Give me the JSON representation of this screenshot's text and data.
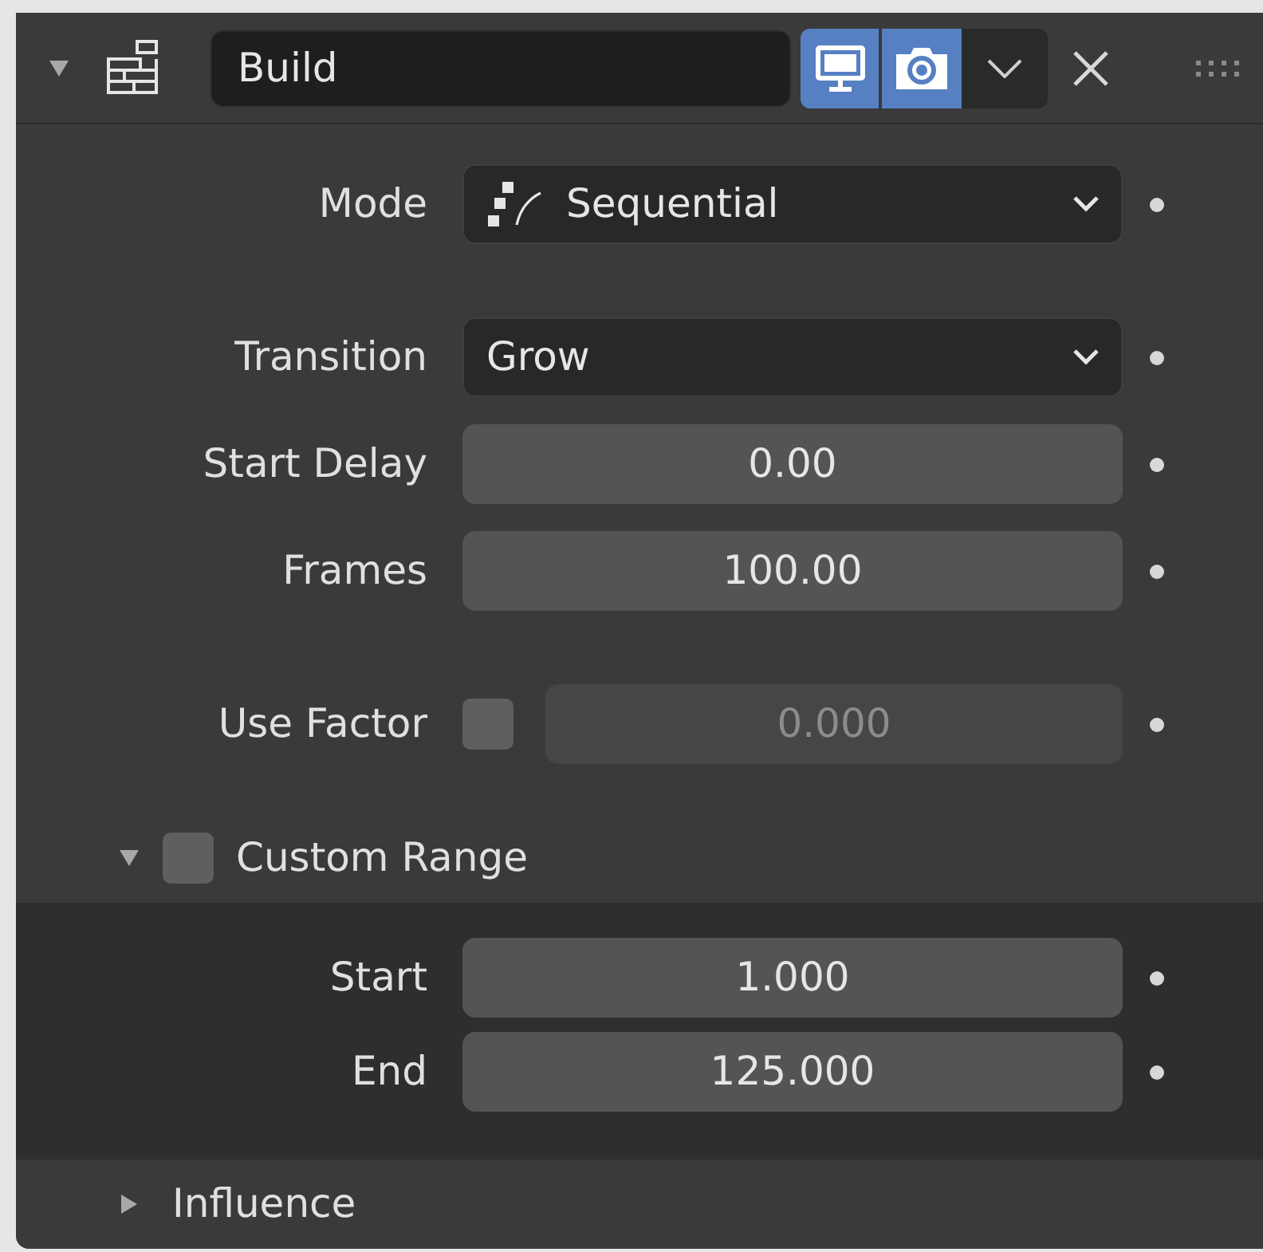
{
  "header": {
    "expanded": true,
    "name": "Build",
    "show_in_viewport": true,
    "show_in_render": true
  },
  "groups": [
    [
      {
        "kind": "dropdown_icon",
        "label": "Mode",
        "value": "Sequential"
      }
    ],
    [
      {
        "kind": "dropdown",
        "label": "Transition",
        "value": "Grow"
      },
      {
        "kind": "number",
        "label": "Start Delay",
        "value": "0.00"
      },
      {
        "kind": "number",
        "label": "Frames",
        "value": "100.00"
      }
    ],
    [
      {
        "kind": "toggle_number",
        "label": "Use Factor",
        "checked": false,
        "value": "0.000"
      }
    ]
  ],
  "subpanels": [
    {
      "label": "Custom Range",
      "expanded": true,
      "checked": false,
      "rows": [
        {
          "kind": "number",
          "label": "Start",
          "value": "1.000"
        },
        {
          "kind": "number",
          "label": "End",
          "value": "125.000"
        }
      ]
    },
    {
      "label": "Influence",
      "expanded": false
    }
  ]
}
